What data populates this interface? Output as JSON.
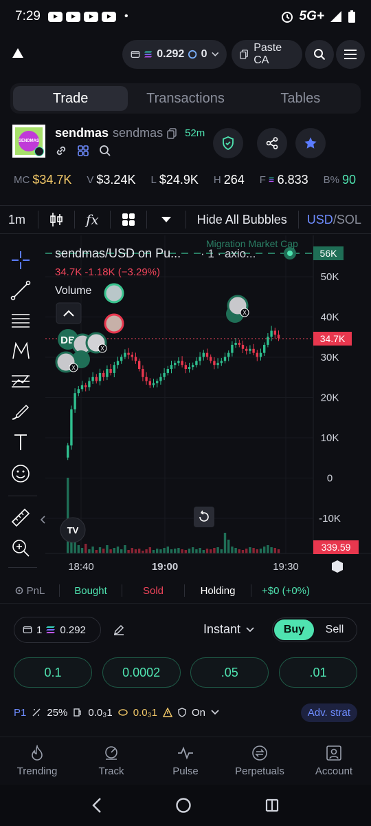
{
  "status_bar": {
    "time": "7:29",
    "dot": "•",
    "network": "5G+"
  },
  "top_bar": {
    "wallet_balance": "0.292",
    "points": "0",
    "paste_label": "Paste CA"
  },
  "tabs": [
    {
      "label": "Trade"
    },
    {
      "label": "Transactions"
    },
    {
      "label": "Tables"
    }
  ],
  "token": {
    "logo_text": "SENDMAS",
    "name": "sendmas",
    "ticker": "sendmas",
    "age": "52m"
  },
  "stats": {
    "mc_label": "MC",
    "mc_value": "$34.7K",
    "v_label": "V",
    "v_value": "$3.24K",
    "l_label": "L",
    "l_value": "$24.9K",
    "h_label": "H",
    "h_value": "264",
    "f_label": "F",
    "f_value": "6.833",
    "b_label": "B%",
    "b_value": "90"
  },
  "chart_toolbar": {
    "interval": "1m",
    "fx": "fx",
    "hide_bubbles": "Hide All Bubbles",
    "currency_usd": "USD",
    "currency_sol": "SOL"
  },
  "chart": {
    "pair_title": "sendmas/USD on Pu...",
    "pair_extra": "· 1 · axio...",
    "migration_label": "Migration Market Cap",
    "migration_value": "56K",
    "ohlc_text": "34.7K  -1.18K (−3.29%)",
    "volume_label": "Volume",
    "current_price_tag": "34.7K",
    "volume_tag": "339.59",
    "bubble_db": "DB",
    "bubble_x": "X",
    "tv_logo": "TV",
    "y_ticks": [
      "50K",
      "40K",
      "30K",
      "20K",
      "10K",
      "0",
      "-10K"
    ],
    "x_ticks": [
      "18:40",
      "19:00",
      "19:30"
    ]
  },
  "pnl": {
    "label": "PnL",
    "bought": "Bought",
    "sold": "Sold",
    "holding": "Holding",
    "value": "+$0 (+0%)"
  },
  "trade": {
    "preset_num": "1",
    "wallet_amount": "0.292",
    "mode": "Instant",
    "buy_label": "Buy",
    "sell_label": "Sell",
    "amounts": [
      "0.1",
      "0.0002",
      ".05",
      ".01"
    ],
    "settings": {
      "preset": "P1",
      "slippage": "25%",
      "priority": "0.0₃1",
      "bribe": "0.0₃1",
      "mev": "On",
      "adv": "Adv. strat"
    }
  },
  "nav": [
    {
      "label": "Trending"
    },
    {
      "label": "Track"
    },
    {
      "label": "Pulse"
    },
    {
      "label": "Perpetuals"
    },
    {
      "label": "Account"
    }
  ],
  "colors": {
    "accent_green": "#4fe3b0",
    "accent_red": "#f0455b",
    "mc_yellow": "#f3c969",
    "blue": "#5b7cff"
  }
}
